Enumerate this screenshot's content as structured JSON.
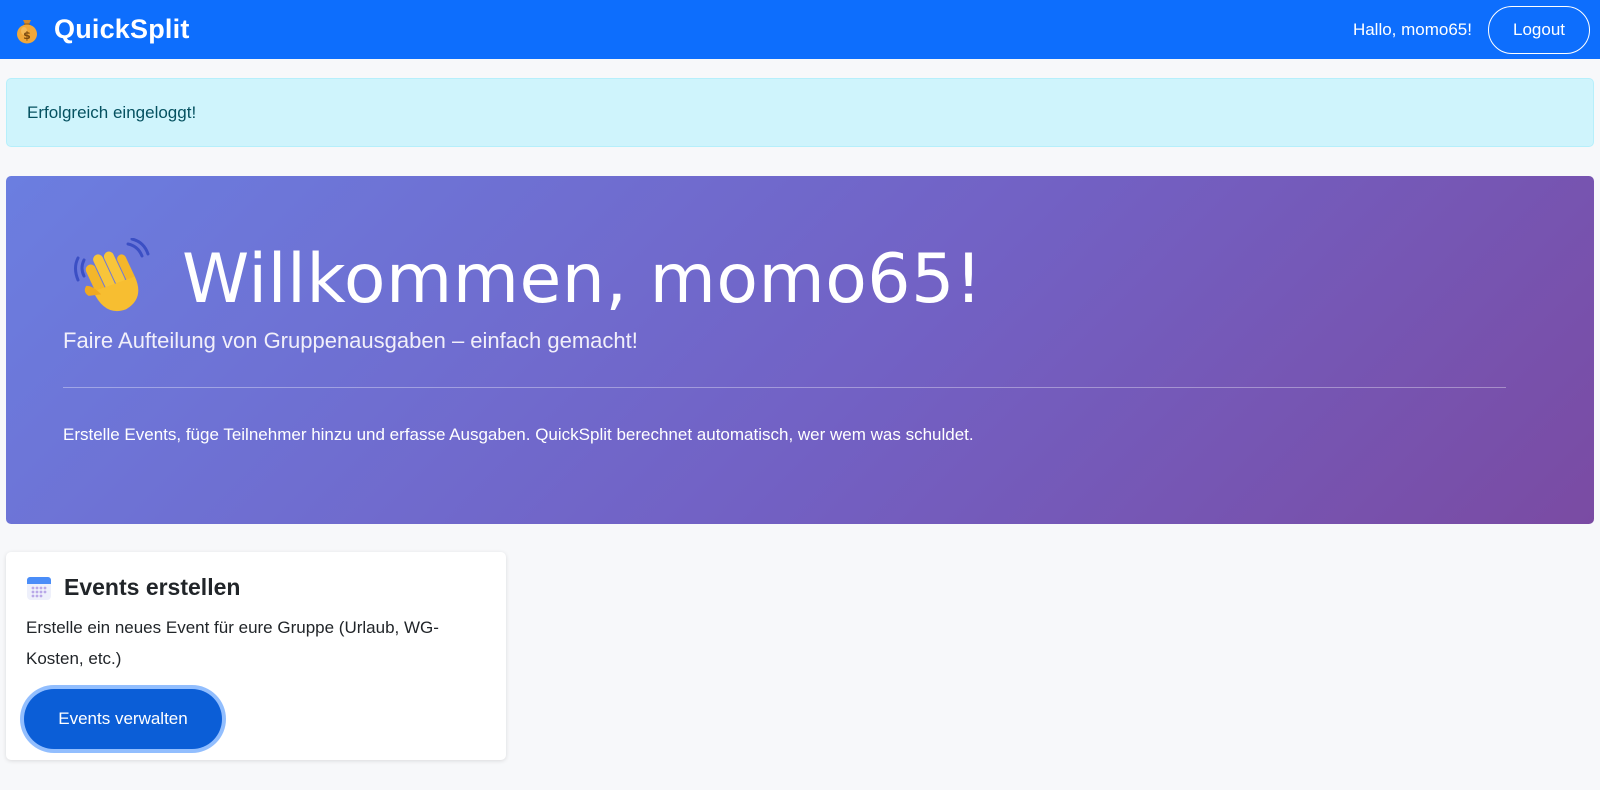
{
  "navbar": {
    "brand_icon": "money-bag-icon",
    "brand_name": "QuickSplit",
    "greeting": "Hallo, momo65!",
    "logout_label": "Logout",
    "color": "#0d6efd"
  },
  "alert": {
    "message": "Erfolgreich eingeloggt!",
    "color": "#cff4fc"
  },
  "hero": {
    "icon": "waving-hand-icon",
    "title": "Willkommen, momo65!",
    "lead": "Faire Aufteilung von Gruppenausgaben – einfach gemacht!",
    "text": "Erstelle Events, füge Teilnehmer hinzu und erfasse Ausgaben. QuickSplit berechnet automatisch, wer wem was schuldet."
  },
  "card": {
    "icon": "calendar-icon",
    "title": "Events erstellen",
    "text": "Erstelle ein neues Event für eure Gruppe (Urlaub, WG-Kosten, etc.)",
    "button_label": "Events verwalten"
  }
}
